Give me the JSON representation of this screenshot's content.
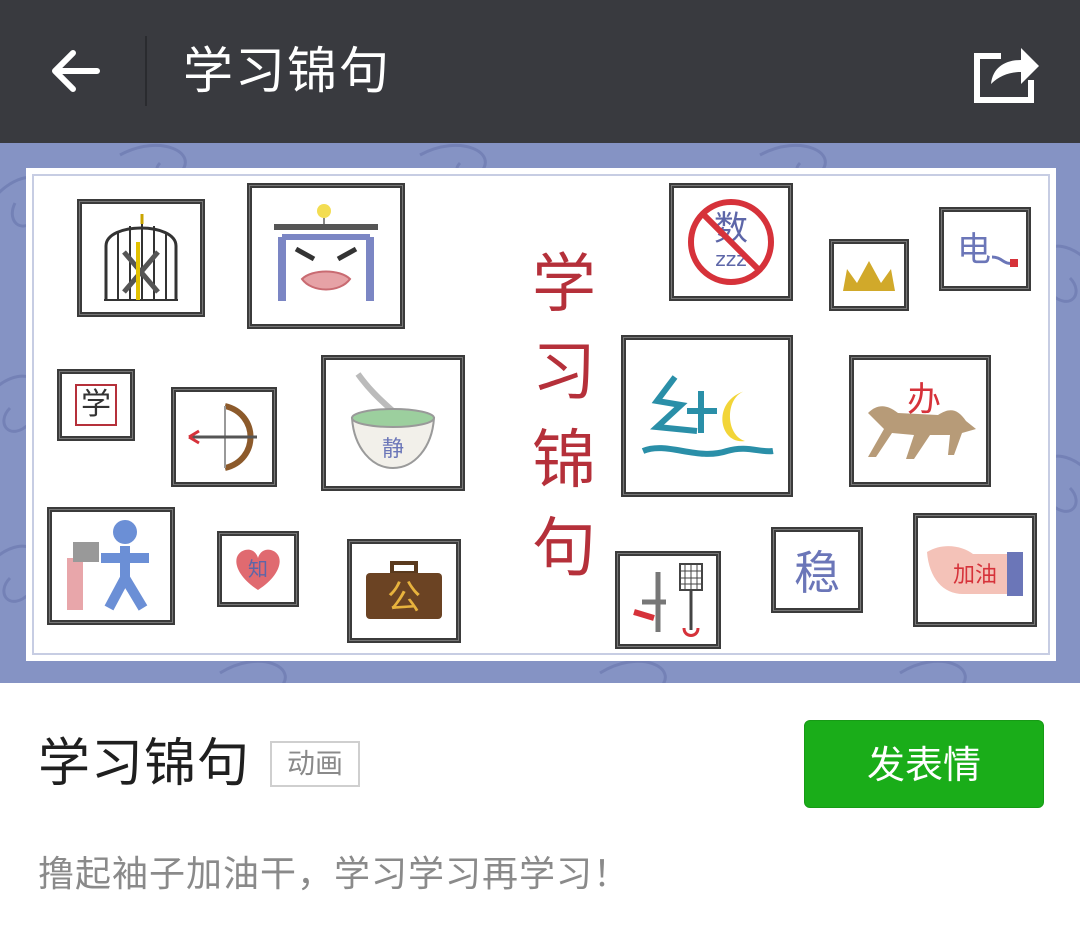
{
  "header": {
    "title": "学习锦句",
    "back_icon": "back-arrow-icon",
    "share_icon": "share-icon",
    "background": "#393a3f"
  },
  "banner": {
    "vertical_title": "学习锦句",
    "background": "#8593c4",
    "frame_glyphs": {
      "xue": "学",
      "shu": "数",
      "dian": "电",
      "jing": "静",
      "gong": "公",
      "ban": "办",
      "wen": "稳",
      "jiayou": "加油",
      "zhi": "知",
      "you": "幼"
    },
    "zzz": "zzz"
  },
  "sticker": {
    "name": "学习锦句",
    "tag": "动画",
    "description": "撸起袖子加油干，学习学习再学习！",
    "send_label": "发表情",
    "accent": "#1aad19"
  }
}
